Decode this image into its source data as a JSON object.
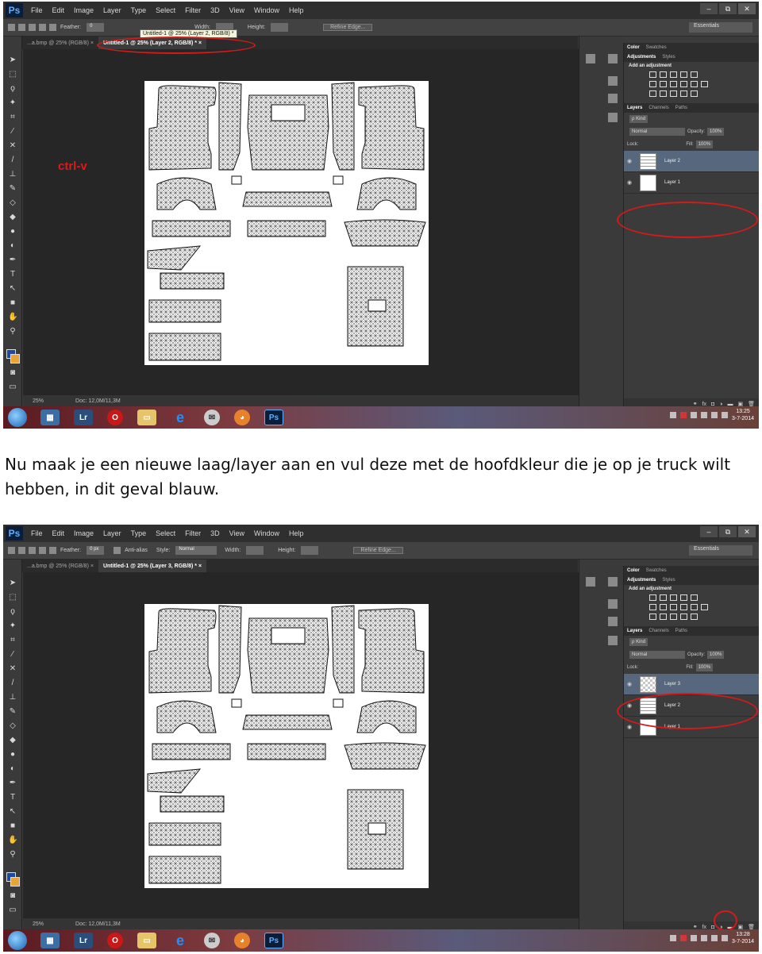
{
  "caption": "Nu maak je een nieuwe laag/layer aan en vul deze met de hoofdkleur die je op je truck wilt hebben, in dit geval blauw.",
  "screenshots": [
    {
      "menu": [
        "File",
        "Edit",
        "Image",
        "Layer",
        "Type",
        "Select",
        "Filter",
        "3D",
        "View",
        "Window",
        "Help"
      ],
      "win_buttons": [
        "–",
        "⧉",
        "✕"
      ],
      "options": {
        "feather_label": "Feather:",
        "feather_value": "0",
        "tooltip": "Untitled-1 @ 25% (Layer 2, RGB/8) *",
        "style_label": "Style:",
        "style_value": "Normal",
        "width_label": "Width:",
        "height_label": "Height:",
        "refine": "Refine Edge...",
        "workspace": "Essentials"
      },
      "tabs": [
        "...a.bmp @ 25% (RGB/8) ×",
        "Untitled-1 @ 25% (Layer 2, RGB/8) * ×"
      ],
      "status": {
        "zoom": "25%",
        "doc": "Doc: 12,0M/11,3M"
      },
      "annotation": "ctrl-v",
      "panel_tabs_top": [
        "Color",
        "Swatches"
      ],
      "panel_tabs_adj": [
        "Adjustments",
        "Styles"
      ],
      "adj_title": "Add an adjustment",
      "panel_tabs_layers": [
        "Layers",
        "Channels",
        "Paths"
      ],
      "kind_label": "ρ Kind",
      "blend_mode": "Normal",
      "opacity_label": "Opacity:",
      "opacity": "100%",
      "lock_label": "Lock:",
      "fill_label": "Fill:",
      "fill": "100%",
      "layers": [
        {
          "name": "Layer 2",
          "thumb": "pattern",
          "selected": true
        },
        {
          "name": "Layer 1",
          "thumb": "white",
          "selected": false
        }
      ],
      "clock_time": "13:25",
      "clock_date": "3-7-2014"
    },
    {
      "menu": [
        "File",
        "Edit",
        "Image",
        "Layer",
        "Type",
        "Select",
        "Filter",
        "3D",
        "View",
        "Window",
        "Help"
      ],
      "win_buttons": [
        "–",
        "⧉",
        "✕"
      ],
      "options": {
        "feather_label": "Feather:",
        "feather_value": "0 px",
        "antialias": "Anti-alias",
        "style_label": "Style:",
        "style_value": "Normal",
        "width_label": "Width:",
        "height_label": "Height:",
        "refine": "Refine Edge...",
        "workspace": "Essentials"
      },
      "tabs": [
        "...a.bmp @ 25% (RGB/8) ×",
        "Untitled-1 @ 25% (Layer 3, RGB/8) * ×"
      ],
      "status": {
        "zoom": "25%",
        "doc": "Doc: 12,0M/11,3M"
      },
      "panel_tabs_top": [
        "Color",
        "Swatches"
      ],
      "panel_tabs_adj": [
        "Adjustments",
        "Styles"
      ],
      "adj_title": "Add an adjustment",
      "panel_tabs_layers": [
        "Layers",
        "Channels",
        "Paths"
      ],
      "kind_label": "ρ Kind",
      "blend_mode": "Normal",
      "opacity_label": "Opacity:",
      "opacity": "100%",
      "lock_label": "Lock:",
      "fill_label": "Fill:",
      "fill": "100%",
      "layers": [
        {
          "name": "Layer 3",
          "thumb": "checker",
          "selected": true
        },
        {
          "name": "Layer 2",
          "thumb": "pattern",
          "selected": false
        },
        {
          "name": "Layer 1",
          "thumb": "white",
          "selected": false
        }
      ],
      "clock_time": "13:28",
      "clock_date": "3-7-2014"
    }
  ]
}
